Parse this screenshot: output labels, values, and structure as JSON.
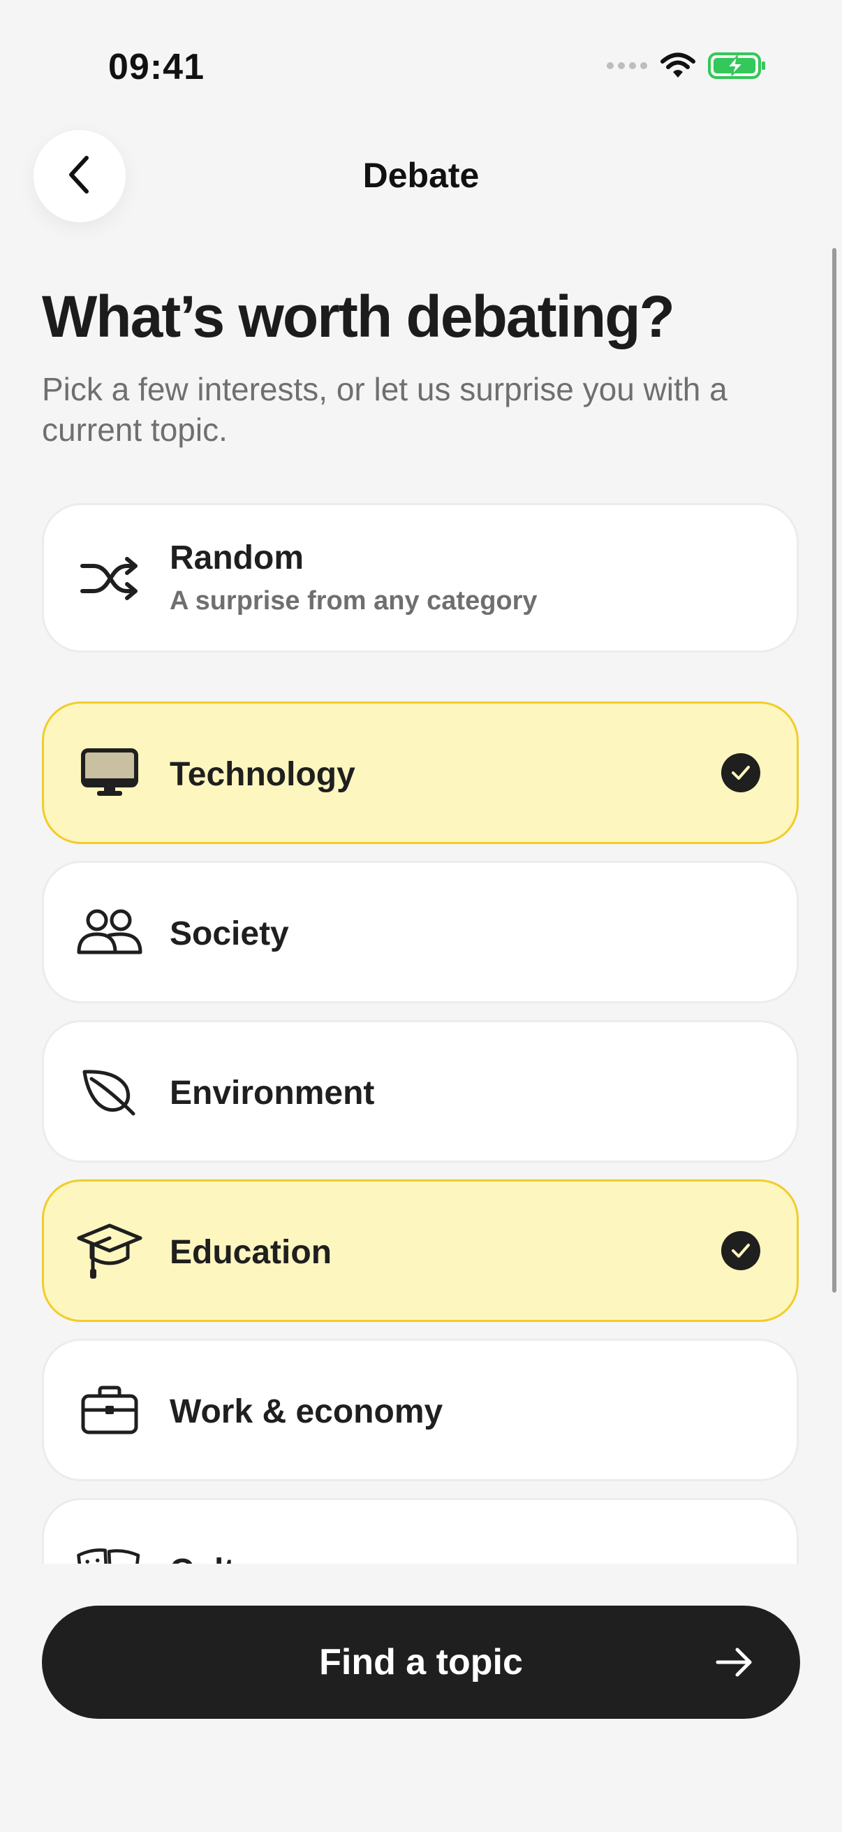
{
  "status_bar": {
    "time": "09:41",
    "icons": [
      "cellular-dots-icon",
      "wifi-icon",
      "battery-charging-icon"
    ]
  },
  "header": {
    "title": "Debate",
    "back_icon": "chevron-left-icon"
  },
  "intro": {
    "headline": "What’s worth debating?",
    "subheadline": "Pick a few interests, or let us surprise you with a current topic."
  },
  "random_option": {
    "label": "Random",
    "sublabel": "A surprise from any category",
    "icon": "shuffle-icon"
  },
  "categories": [
    {
      "label": "Technology",
      "icon": "monitor-icon",
      "selected": true
    },
    {
      "label": "Society",
      "icon": "people-icon",
      "selected": false
    },
    {
      "label": "Environment",
      "icon": "leaf-icon",
      "selected": false
    },
    {
      "label": "Education",
      "icon": "graduation-cap-icon",
      "selected": true
    },
    {
      "label": "Work & economy",
      "icon": "briefcase-icon",
      "selected": false
    },
    {
      "label": "Cult",
      "icon": "theater-masks-icon",
      "selected": false
    }
  ],
  "cta": {
    "label": "Find a topic",
    "icon": "arrow-right-icon"
  },
  "colors": {
    "background": "#f5f5f5",
    "selected_fill": "#fef6bf",
    "selected_border": "#f0cd2a",
    "primary_dark": "#1f1f1f",
    "battery_green": "#34c759"
  }
}
